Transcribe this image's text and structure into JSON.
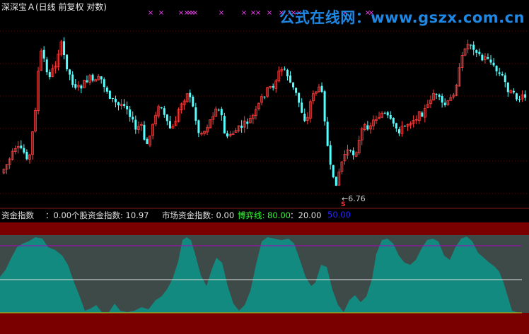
{
  "window": {
    "title": "深深宝Ａ(日线 前复权 对数)"
  },
  "watermark": {
    "text": "公式在线网：www.gszx.com.cn"
  },
  "main_chart": {
    "low_label": "←6.76",
    "signal_mark": "S",
    "marker_glyph": "×"
  },
  "indicator": {
    "name": "资金指数",
    "value_text": "：0.00",
    "stock_fund_label": "个股资金指数: 10.97",
    "market_fund_label": "市场资金指数: 0.00",
    "game_line_label": "博弈线: 80.00",
    "level_20": "：20.00",
    "level_50": "50.00"
  },
  "colors": {
    "background": "#000000",
    "up_candle": "#ff3c3c",
    "down_candle": "#54ffff",
    "marker": "#ff40ff",
    "fund_area": "#138a80",
    "gray_area": "#3e4a48",
    "red_band": "#7a0000",
    "line_80": "#b000c0",
    "line_50": "#e0e0e0",
    "line_20": "#c8b400"
  }
}
